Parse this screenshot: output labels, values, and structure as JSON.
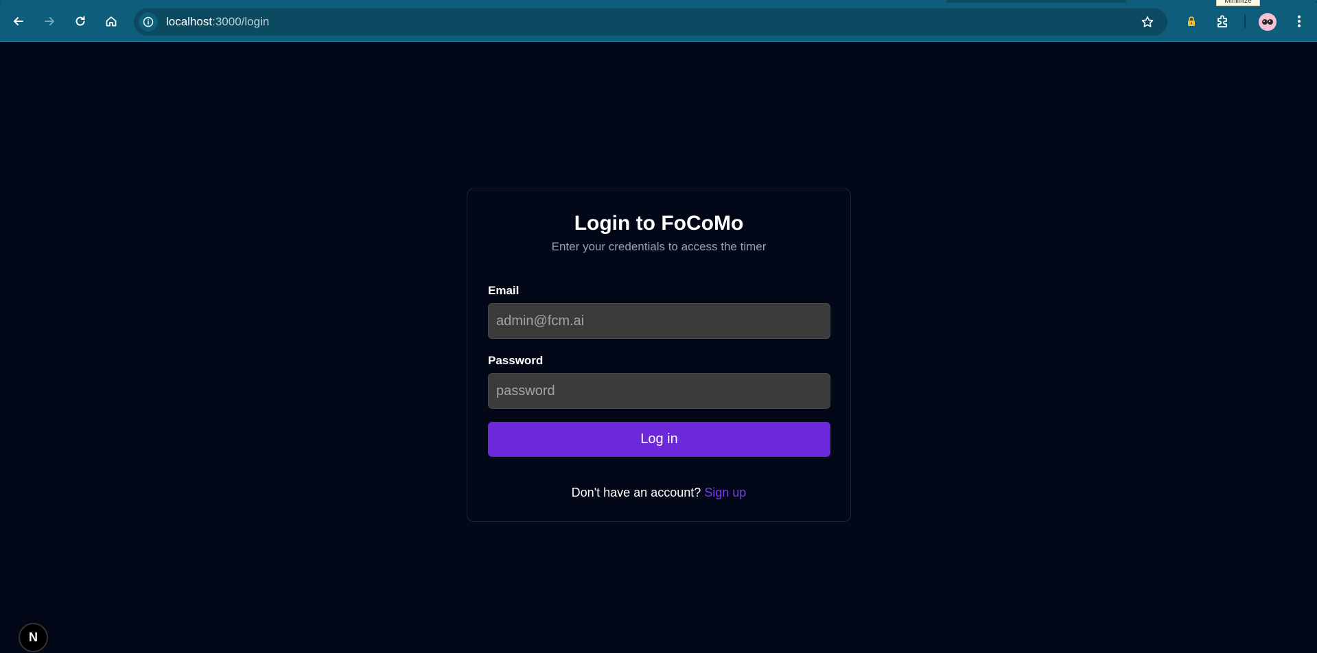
{
  "browser": {
    "url_host": "localhost",
    "url_path": ":3000/login",
    "tooltip": "Minimize"
  },
  "login": {
    "title": "Login to FoCoMo",
    "subtitle": "Enter your credentials to access the timer",
    "email_label": "Email",
    "email_placeholder": "admin@fcm.ai",
    "password_label": "Password",
    "password_placeholder": "password",
    "submit_label": "Log in",
    "signup_prompt": "Don't have an account?",
    "signup_link": "Sign up"
  },
  "dev_badge": {
    "letter": "N"
  },
  "colors": {
    "accent": "#6d28d9",
    "link": "#7c3aed",
    "background": "#020817",
    "chrome": "#0e5d7a"
  }
}
